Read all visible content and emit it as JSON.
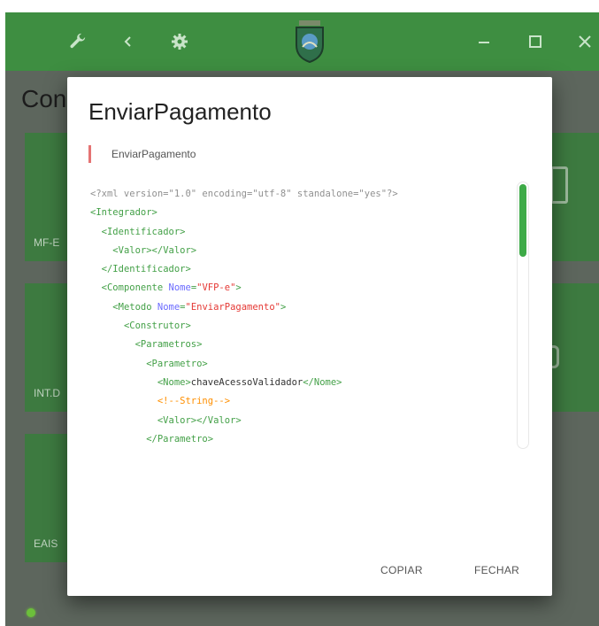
{
  "app": {
    "page_title": "Con",
    "cards": [
      {
        "label": "MF-E"
      },
      {
        "label": "INT.D"
      },
      {
        "label": "EAIS"
      }
    ]
  },
  "dialog": {
    "title": "EnviarPagamento",
    "subtitle": "EnviarPagamento",
    "code_lines": [
      [
        {
          "c": "t-decl",
          "t": "<?xml version=\"1.0\" encoding=\"utf-8\" standalone=\"yes\"?>"
        }
      ],
      [
        {
          "c": "t-tag",
          "t": "<Integrador>"
        }
      ],
      [
        {
          "c": "t-text",
          "t": "  "
        },
        {
          "c": "t-tag",
          "t": "<Identificador>"
        }
      ],
      [
        {
          "c": "t-text",
          "t": "    "
        },
        {
          "c": "t-tag",
          "t": "<Valor></Valor>"
        }
      ],
      [
        {
          "c": "t-text",
          "t": "  "
        },
        {
          "c": "t-tag",
          "t": "</Identificador>"
        }
      ],
      [
        {
          "c": "t-text",
          "t": "  "
        },
        {
          "c": "t-tag",
          "t": "<Componente "
        },
        {
          "c": "t-attr",
          "t": "Nome"
        },
        {
          "c": "t-eq",
          "t": "="
        },
        {
          "c": "t-str",
          "t": "\"VFP-e\""
        },
        {
          "c": "t-tag",
          "t": ">"
        }
      ],
      [
        {
          "c": "t-text",
          "t": "    "
        },
        {
          "c": "t-tag",
          "t": "<Metodo "
        },
        {
          "c": "t-attr",
          "t": "Nome"
        },
        {
          "c": "t-eq",
          "t": "="
        },
        {
          "c": "t-str",
          "t": "\"EnviarPagamento\""
        },
        {
          "c": "t-tag",
          "t": ">"
        }
      ],
      [
        {
          "c": "t-text",
          "t": "      "
        },
        {
          "c": "t-tag",
          "t": "<Construtor>"
        }
      ],
      [
        {
          "c": "t-text",
          "t": "        "
        },
        {
          "c": "t-tag",
          "t": "<Parametros>"
        }
      ],
      [
        {
          "c": "t-text",
          "t": "          "
        },
        {
          "c": "t-tag",
          "t": "<Parametro>"
        }
      ],
      [
        {
          "c": "t-text",
          "t": "            "
        },
        {
          "c": "t-tag",
          "t": "<Nome>"
        },
        {
          "c": "t-text",
          "t": "chaveAcessoValidador"
        },
        {
          "c": "t-tag",
          "t": "</Nome>"
        }
      ],
      [
        {
          "c": "t-text",
          "t": "            "
        },
        {
          "c": "t-comment",
          "t": "<!--String-->"
        }
      ],
      [
        {
          "c": "t-text",
          "t": "            "
        },
        {
          "c": "t-tag",
          "t": "<Valor></Valor>"
        }
      ],
      [
        {
          "c": "t-text",
          "t": "          "
        },
        {
          "c": "t-tag",
          "t": "</Parametro>"
        }
      ]
    ],
    "buttons": {
      "copy": "COPIAR",
      "close": "FECHAR"
    }
  },
  "colors": {
    "titlebar": "#3e8e41",
    "accent_green": "#3daa47",
    "string_red": "#e53935",
    "attr_blue": "#6b6bff",
    "comment_orange": "#ff8f00"
  },
  "icons": [
    "wrench-icon",
    "back-chevron-icon",
    "gear-icon",
    "crest-logo",
    "minimize-icon",
    "maximize-icon",
    "close-icon",
    "card-device-icon",
    "status-dot"
  ]
}
